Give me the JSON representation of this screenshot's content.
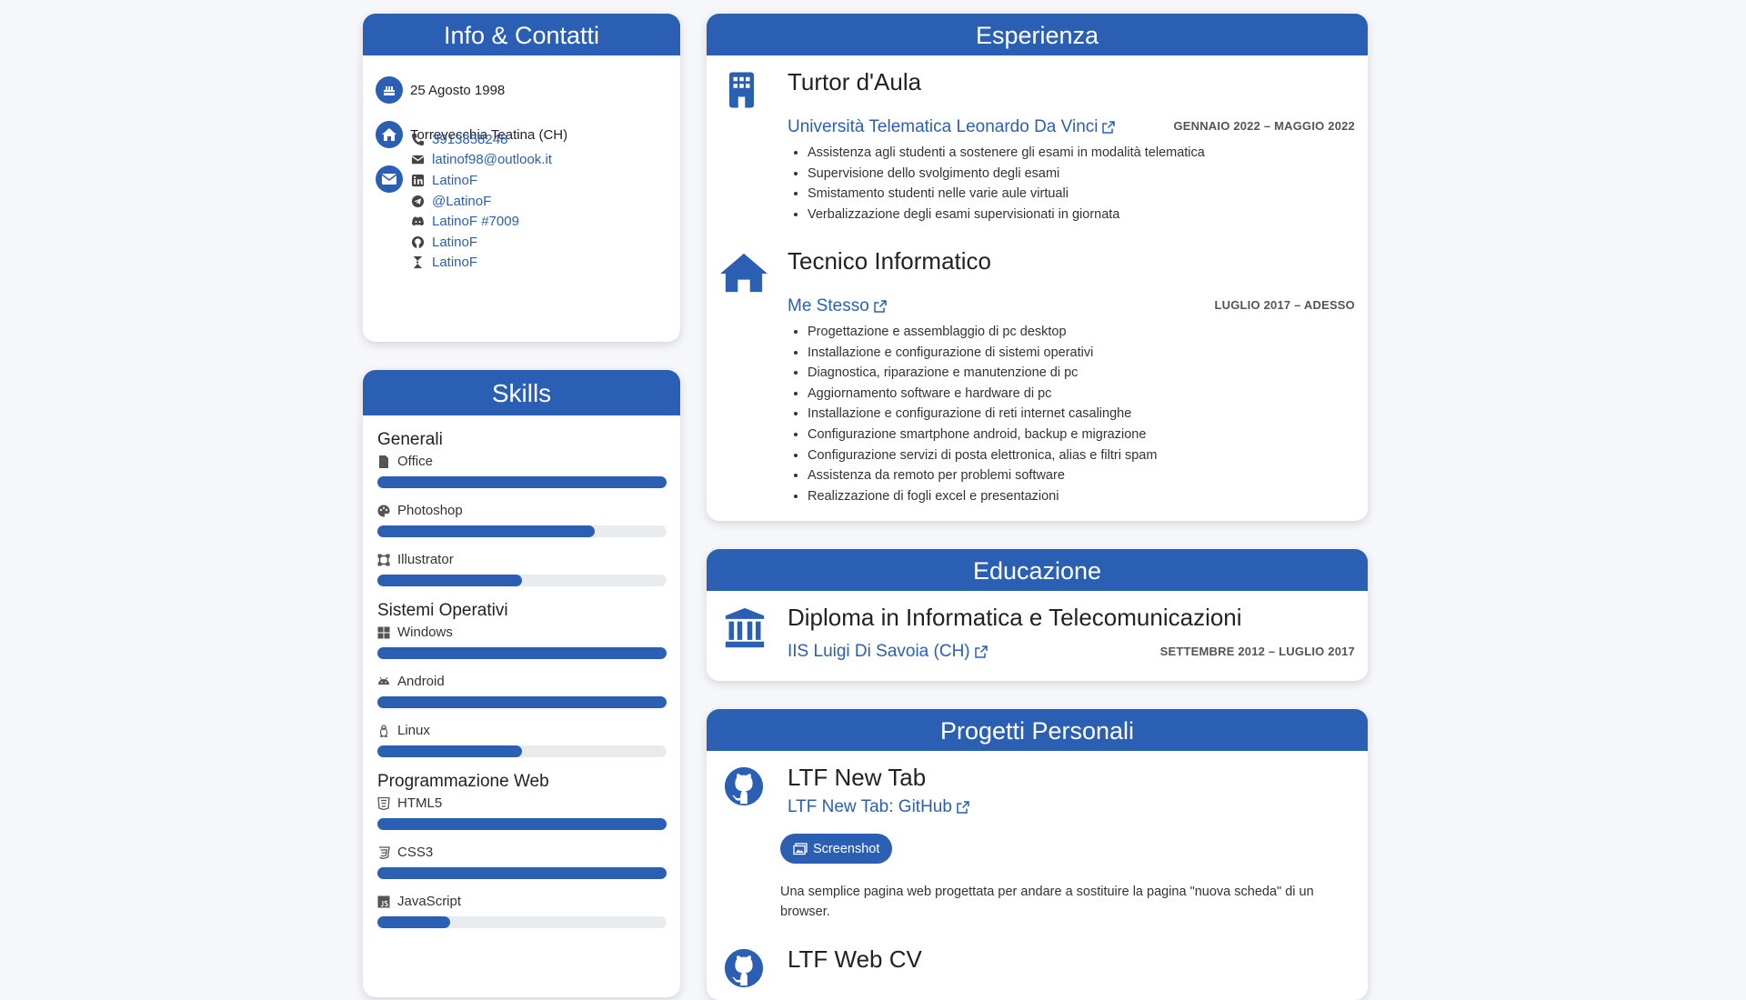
{
  "info": {
    "title": "Info & Contatti",
    "birthdate": "25 Agosto 1998",
    "location": "Torrevecchia Teatina (CH)",
    "contacts": [
      {
        "icon": "phone-icon",
        "text": "3913858248"
      },
      {
        "icon": "envelope-icon",
        "text": "latinof98@outlook.it"
      },
      {
        "icon": "linkedin-icon",
        "text": "LatinoF"
      },
      {
        "icon": "telegram-icon",
        "text": "@LatinoF"
      },
      {
        "icon": "discord-icon",
        "text": "LatinoF #7009"
      },
      {
        "icon": "github-icon",
        "text": "LatinoF"
      },
      {
        "icon": "codewars-icon",
        "text": "LatinoF"
      }
    ]
  },
  "skills": {
    "title": "Skills",
    "groups": [
      {
        "name": "Generali",
        "items": [
          {
            "icon": "file-icon",
            "label": "Office",
            "level": 1.0
          },
          {
            "icon": "palette-icon",
            "label": "Photoshop",
            "level": 0.75
          },
          {
            "icon": "vector-icon",
            "label": "Illustrator",
            "level": 0.5
          }
        ]
      },
      {
        "name": "Sistemi Operativi",
        "items": [
          {
            "icon": "windows-icon",
            "label": "Windows",
            "level": 1.0
          },
          {
            "icon": "android-icon",
            "label": "Android",
            "level": 1.0
          },
          {
            "icon": "linux-icon",
            "label": "Linux",
            "level": 0.5
          }
        ]
      },
      {
        "name": "Programmazione Web",
        "items": [
          {
            "icon": "html5-icon",
            "label": "HTML5",
            "level": 1.0
          },
          {
            "icon": "css3-icon",
            "label": "CSS3",
            "level": 1.0
          },
          {
            "icon": "javascript-icon",
            "label": "JavaScript",
            "level": 0.25
          }
        ]
      }
    ]
  },
  "experience": {
    "title": "Esperienza",
    "jobs": [
      {
        "icon": "building-icon",
        "title": "Turtor d'Aula",
        "org": "Università Telematica Leonardo Da Vinci",
        "date": "GENNAIO 2022 – MAGGIO 2022",
        "bullets": [
          "Assistenza agli studenti a sostenere gli esami in modalità telematica",
          "Supervisione dello svolgimento degli esami",
          "Smistamento studenti nelle varie aule virtuali",
          "Verbalizzazione degli esami supervisionati in giornata"
        ]
      },
      {
        "icon": "house-icon",
        "title": "Tecnico Informatico",
        "org": "Me Stesso",
        "date": "LUGLIO 2017 – ADESSO",
        "bullets": [
          "Progettazione e assemblaggio di pc desktop",
          "Installazione e configurazione di sistemi operativi",
          "Diagnostica, riparazione e manutenzione di pc",
          "Aggiornamento software e hardware di pc",
          "Installazione e configurazione di reti internet casalinghe",
          "Configurazione smartphone android, backup e migrazione",
          "Configurazione servizi di posta elettronica, alias e filtri spam",
          "Assistenza da remoto per problemi software",
          "Realizzazione di fogli excel e presentazioni"
        ]
      }
    ]
  },
  "education": {
    "title": "Educazione",
    "degree": "Diploma in Informatica e Telecomunicazioni",
    "school": "IIS Luigi Di Savoia (CH)",
    "date": "SETTEMBRE 2012 – LUGLIO 2017"
  },
  "projects": {
    "title": "Progetti Personali",
    "items": [
      {
        "title": "LTF New Tab",
        "link": "LTF New Tab: GitHub",
        "button": "Screenshot",
        "description": "Una semplice pagina web progettata per andare a sostituire la pagina \"nuova scheda\" di un browser."
      },
      {
        "title": "LTF Web CV"
      }
    ]
  },
  "colors": {
    "accent": "#2b5fb3",
    "background": "#f6f7fb",
    "bar_track": "#e9ecef"
  }
}
